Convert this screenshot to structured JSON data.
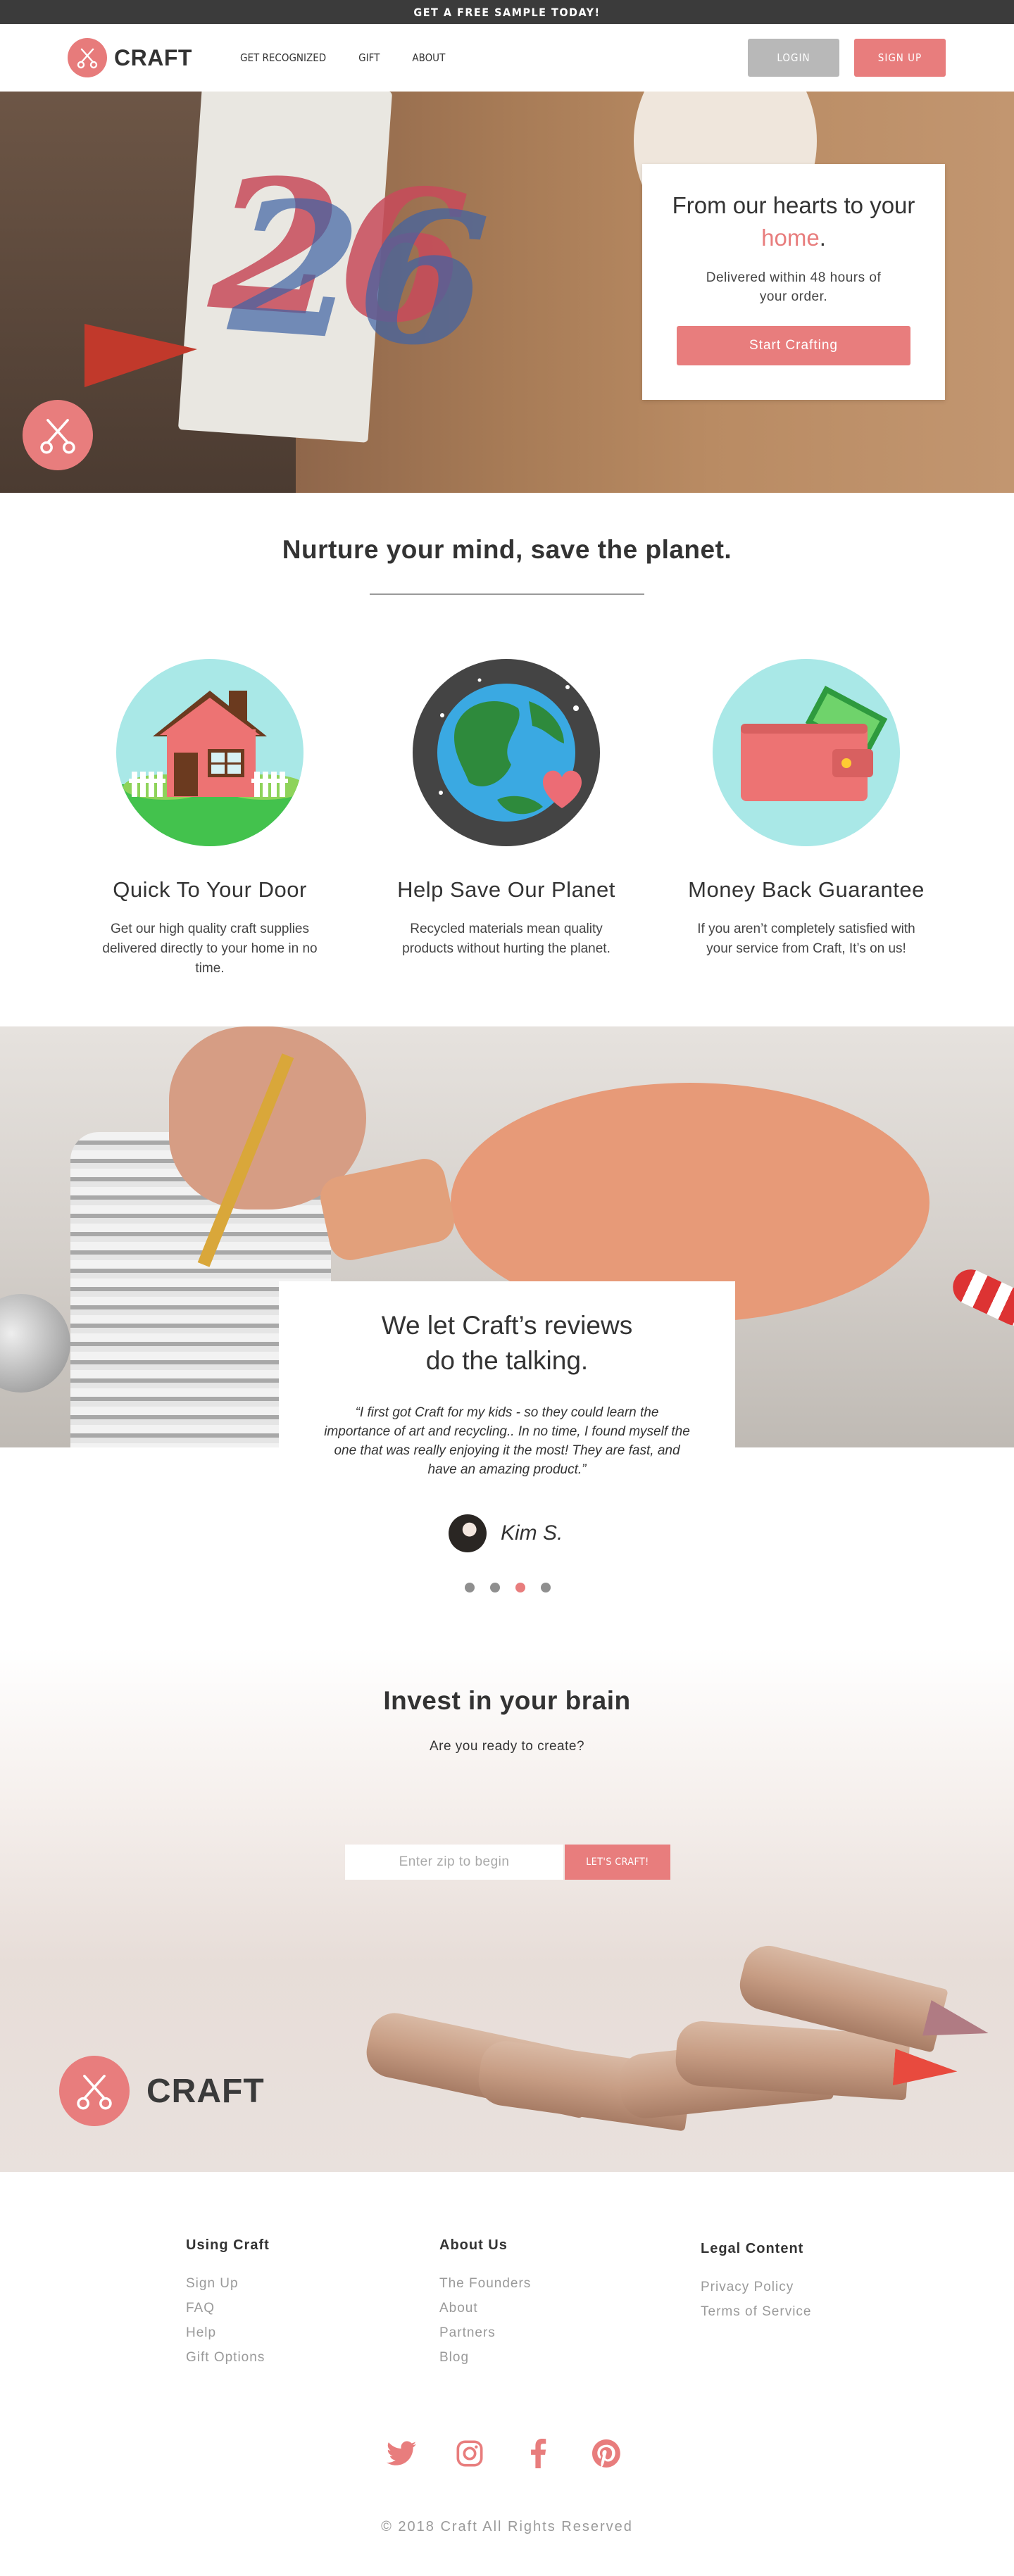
{
  "banner": {
    "text": "GET A FREE SAMPLE TODAY!"
  },
  "nav": {
    "logo_text": "CRAFT",
    "links": [
      "GET RECOGNIZED",
      "GIFT",
      "ABOUT"
    ],
    "login_label": "LOGIN",
    "signup_label": "SIGN UP"
  },
  "hero": {
    "title_part1": "From our hearts to your ",
    "title_accent": "home",
    "title_end": ".",
    "subtitle": "Delivered within 48 hours of your order.",
    "cta_label": "Start Crafting",
    "shirt_text": "26"
  },
  "mission": {
    "title": "Nurture your mind, save the planet.",
    "features": [
      {
        "title": "Quick To Your Door",
        "text": "Get our high quality craft supplies delivered directly to your home in no time.",
        "icon": "house-icon"
      },
      {
        "title": "Help Save Our Planet",
        "text": "Recycled materials mean quality products without hurting the planet.",
        "icon": "planet-heart-icon"
      },
      {
        "title": "Money Back Guarantee",
        "text": "If you aren’t completely satisfied with your service from Craft, It’s on us!",
        "icon": "wallet-icon"
      }
    ]
  },
  "reviews": {
    "title_line1": "We let Craft’s reviews",
    "title_line2": "do the talking.",
    "quote": "“I first got Craft for my kids - so they could learn the importance of art and recycling.. In no time, I found myself the one that was really enjoying it the most! They are fast, and have an amazing product.”",
    "author": "Kim S.",
    "dots": 4,
    "active_dot": 2
  },
  "invest": {
    "title": "Invest in your brain",
    "subtitle": "Are you ready to create?",
    "zip_placeholder": "Enter zip to begin",
    "button_label": "LET'S CRAFT!",
    "logo_text": "CRAFT"
  },
  "footer": {
    "columns": [
      {
        "heading": "Using Craft",
        "links": [
          "Sign Up",
          "FAQ",
          "Help",
          "Gift Options"
        ]
      },
      {
        "heading": "About Us",
        "links": [
          "The Founders",
          "About",
          "Partners",
          "Blog"
        ]
      },
      {
        "heading": "Legal Content",
        "links": [
          "Privacy Policy",
          "Terms of Service"
        ]
      }
    ],
    "social": [
      "twitter-icon",
      "instagram-icon",
      "facebook-icon",
      "pinterest-icon"
    ],
    "copyright": "© 2018 Craft All Rights Reserved"
  },
  "colors": {
    "accent": "#e87d7d",
    "dark": "#3b3b3b",
    "muted": "#9a9a9a",
    "login_gray": "#b8b8b8"
  }
}
